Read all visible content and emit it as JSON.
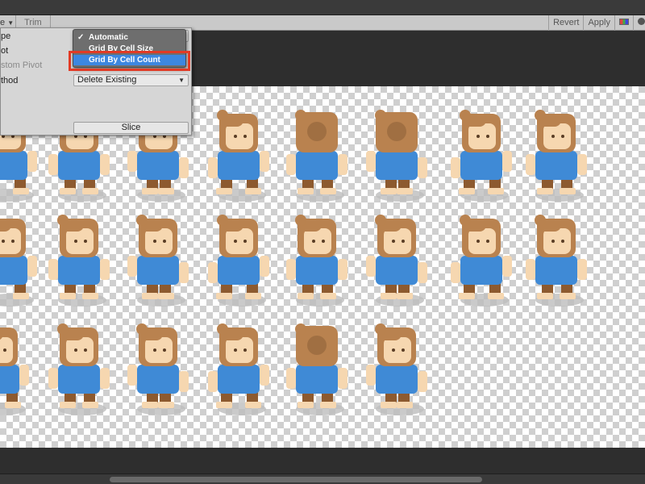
{
  "toolbar": {
    "type_label": "e",
    "trim_label": "Trim",
    "revert_label": "Revert",
    "apply_label": "Apply",
    "channel_icon": "rgb-channels-icon",
    "alpha_icon": "alpha-toggle-icon"
  },
  "slice_panel": {
    "type_label": "pe",
    "pivot_label": "ot",
    "custom_pivot_label": "stom Pivot",
    "method_label": "thod",
    "method_value": "Delete Existing",
    "slice_button": "Slice"
  },
  "type_menu": {
    "items": [
      {
        "label": "Automatic",
        "checked": true,
        "selected": false
      },
      {
        "label": "Grid By Cell Size",
        "checked": false,
        "selected": false
      },
      {
        "label": "Grid By Cell Count",
        "checked": false,
        "selected": true
      }
    ]
  },
  "colors": {
    "accent_selection": "#3d87e0",
    "highlight_border": "#e23a25",
    "shirt": "#3f8ad6",
    "hair": "#b9824f",
    "skin": "#f6d7b0",
    "pants": "#8d5a2f"
  },
  "sprite_sheet": {
    "rows": 3,
    "frames_per_row": [
      8,
      8,
      6
    ],
    "description_icon": "character-sprite"
  }
}
